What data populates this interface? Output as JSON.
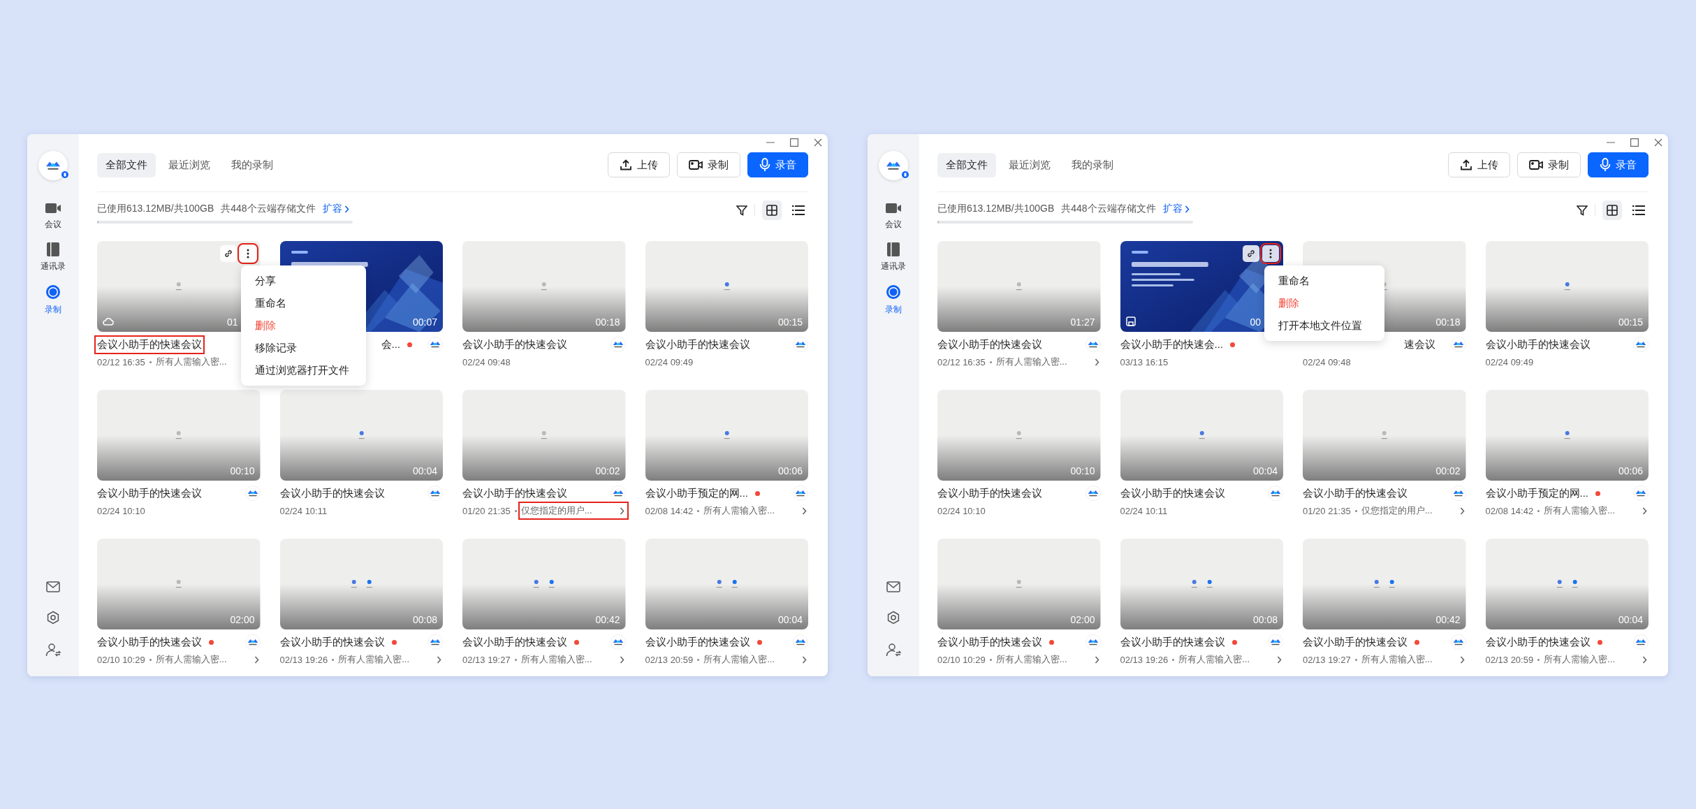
{
  "windows": [
    {
      "sidebar": {
        "items": [
          {
            "label": "会议",
            "selected": false
          },
          {
            "label": "通讯录",
            "selected": false
          },
          {
            "label": "录制",
            "selected": true
          }
        ]
      },
      "tabs": [
        {
          "label": "全部文件",
          "selected": true
        },
        {
          "label": "最近浏览",
          "selected": false
        },
        {
          "label": "我的录制",
          "selected": false
        }
      ],
      "buttons": [
        {
          "label": "上传",
          "kind": "default"
        },
        {
          "label": "录制",
          "kind": "default"
        },
        {
          "label": "录音",
          "kind": "primary"
        }
      ],
      "storage": {
        "used": "已使用613.12MB/共100GB",
        "count": "共448个云端存储文件",
        "link": "扩容",
        "level": 0.006
      },
      "views": [
        {
          "selected": true
        },
        {
          "selected": false
        }
      ],
      "cards": [
        {
          "title": "会议小助手的快速会议",
          "date": "02/12 16:35",
          "access": "所有人需输入密...",
          "duration": "01",
          "kind": "blank",
          "unread": false,
          "hovered": true,
          "cloud": true,
          "title_boxed": true,
          "more_boxed": true,
          "menu": {
            "items": [
              {
                "label": "分享",
                "danger": false
              },
              {
                "label": "重命名",
                "danger": false
              },
              {
                "label": "删除",
                "danger": true
              },
              {
                "label": "移除记录",
                "danger": false
              },
              {
                "label": "通过浏览器打开文件",
                "danger": false
              }
            ]
          }
        },
        {
          "title": "会...",
          "duration": "00:07",
          "kind": "slide",
          "unread": true,
          "hovered": false,
          "covered": true
        },
        {
          "title": "会议小助手的快速会议",
          "date": "02/24 09:48",
          "duration": "00:18",
          "kind": "blank",
          "unread": false,
          "hovered": false
        },
        {
          "title": "会议小助手的快速会议",
          "date": "02/24 09:49",
          "duration": "00:15",
          "kind": "blank",
          "unread": false,
          "hovered": false
        },
        {
          "title": "会议小助手的快速会议",
          "date": "02/24 10:10",
          "duration": "00:10",
          "kind": "blank",
          "unread": false,
          "hovered": false
        },
        {
          "title": "会议小助手的快速会议",
          "date": "02/24 10:11",
          "duration": "00:04",
          "kind": "blank",
          "unread": false,
          "hovered": false
        },
        {
          "title": "会议小助手的快速会议",
          "date": "01/20 21:35",
          "access": "仅您指定的用户...",
          "duration": "00:02",
          "kind": "blank",
          "unread": false,
          "hovered": false,
          "access_boxed": true
        },
        {
          "title": "会议小助手预定的网...",
          "date": "02/08 14:42",
          "access": "所有人需输入密...",
          "duration": "00:06",
          "kind": "blank",
          "unread": true,
          "hovered": false
        },
        {
          "title": "会议小助手的快速会议",
          "date": "02/10 10:29",
          "access": "所有人需输入密...",
          "duration": "02:00",
          "kind": "blank",
          "unread": true,
          "hovered": false
        },
        {
          "title": "会议小助手的快速会议",
          "date": "02/13 19:26",
          "access": "所有人需输入密...",
          "duration": "00:08",
          "kind": "blank",
          "unread": true,
          "hovered": false
        },
        {
          "title": "会议小助手的快速会议",
          "date": "02/13 19:27",
          "access": "所有人需输入密...",
          "duration": "00:42",
          "kind": "blank",
          "unread": true,
          "hovered": false
        },
        {
          "title": "会议小助手的快速会议",
          "date": "02/13 20:59",
          "access": "所有人需输入密...",
          "duration": "00:04",
          "kind": "blank",
          "unread": true,
          "hovered": false
        }
      ]
    },
    {
      "sidebar": {
        "items": [
          {
            "label": "会议",
            "selected": false
          },
          {
            "label": "通讯录",
            "selected": false
          },
          {
            "label": "录制",
            "selected": true
          }
        ]
      },
      "tabs": [
        {
          "label": "全部文件",
          "selected": true
        },
        {
          "label": "最近浏览",
          "selected": false
        },
        {
          "label": "我的录制",
          "selected": false
        }
      ],
      "buttons": [
        {
          "label": "上传",
          "kind": "default"
        },
        {
          "label": "录制",
          "kind": "default"
        },
        {
          "label": "录音",
          "kind": "primary"
        }
      ],
      "storage": {
        "used": "已使用613.12MB/共100GB",
        "count": "共448个云端存储文件",
        "link": "扩容",
        "level": 0.006
      },
      "views": [
        {
          "selected": true
        },
        {
          "selected": false
        }
      ],
      "cards": [
        {
          "title": "会议小助手的快速会议",
          "date": "02/12 16:35",
          "access": "所有人需输入密...",
          "duration": "01:27",
          "kind": "blank",
          "unread": false,
          "hovered": false
        },
        {
          "title": "会议小助手的快速会...",
          "date": "03/13 16:15",
          "duration": "00",
          "kind": "slide",
          "unread": true,
          "hovered": true,
          "cloud": false,
          "more_boxed": true,
          "menu": {
            "items": [
              {
                "label": "重命名",
                "danger": false
              },
              {
                "label": "删除",
                "danger": true
              },
              {
                "label": "打开本地文件位置",
                "danger": false
              }
            ]
          }
        },
        {
          "title": "速会议",
          "date": "02/24 09:48",
          "duration": "00:18",
          "kind": "blank",
          "unread": false,
          "hovered": false,
          "covered": true
        },
        {
          "title": "会议小助手的快速会议",
          "date": "02/24 09:49",
          "duration": "00:15",
          "kind": "blank",
          "unread": false,
          "hovered": false
        },
        {
          "title": "会议小助手的快速会议",
          "date": "02/24 10:10",
          "duration": "00:10",
          "kind": "blank",
          "unread": false,
          "hovered": false
        },
        {
          "title": "会议小助手的快速会议",
          "date": "02/24 10:11",
          "duration": "00:04",
          "kind": "blank",
          "unread": false,
          "hovered": false
        },
        {
          "title": "会议小助手的快速会议",
          "date": "01/20 21:35",
          "access": "仅您指定的用户...",
          "duration": "00:02",
          "kind": "blank",
          "unread": false,
          "hovered": false
        },
        {
          "title": "会议小助手预定的网...",
          "date": "02/08 14:42",
          "access": "所有人需输入密...",
          "duration": "00:06",
          "kind": "blank",
          "unread": true,
          "hovered": false
        },
        {
          "title": "会议小助手的快速会议",
          "date": "02/10 10:29",
          "access": "所有人需输入密...",
          "duration": "02:00",
          "kind": "blank",
          "unread": true,
          "hovered": false
        },
        {
          "title": "会议小助手的快速会议",
          "date": "02/13 19:26",
          "access": "所有人需输入密...",
          "duration": "00:08",
          "kind": "blank",
          "unread": true,
          "hovered": false
        },
        {
          "title": "会议小助手的快速会议",
          "date": "02/13 19:27",
          "access": "所有人需输入密...",
          "duration": "00:42",
          "kind": "blank",
          "unread": true,
          "hovered": false
        },
        {
          "title": "会议小助手的快速会议",
          "date": "02/13 20:59",
          "access": "所有人需输入密...",
          "duration": "00:04",
          "kind": "blank",
          "unread": true,
          "hovered": false
        }
      ]
    }
  ]
}
